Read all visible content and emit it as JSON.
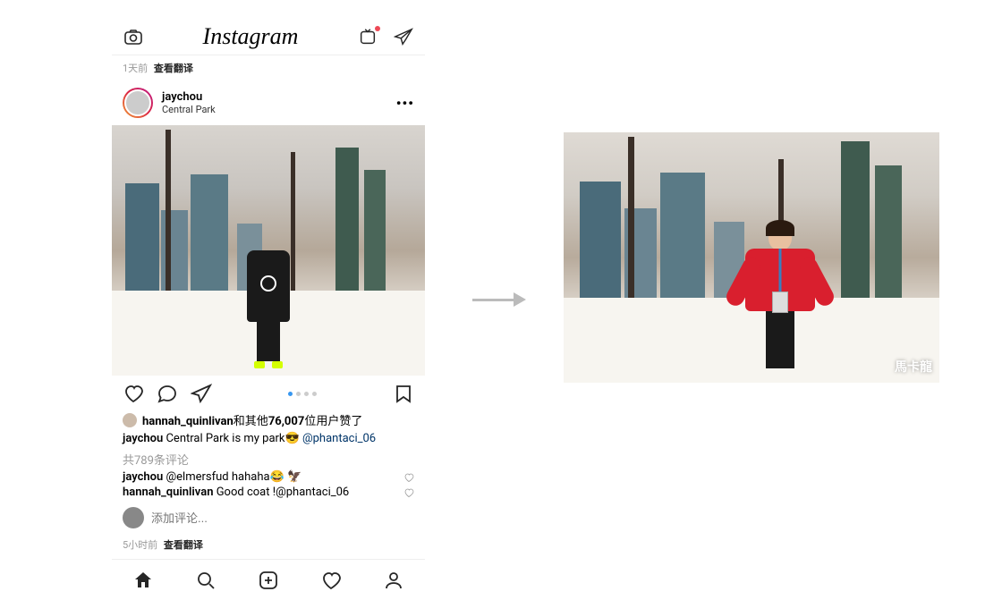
{
  "header": {
    "logo": "Instagram"
  },
  "top_meta": {
    "time": "1天前",
    "translate": "查看翻译"
  },
  "post": {
    "username": "jaychou",
    "location": "Central Park",
    "pager": {
      "count": 4,
      "active": 0
    },
    "likes": {
      "liker": "hannah_quinlivan",
      "text_mid": "和其他",
      "count": "76,007",
      "text_suffix": "位用户赞了"
    },
    "caption": {
      "user": "jaychou",
      "text": "Central Park is my park😎 ",
      "tag": "@phantaci_06"
    },
    "comments_count": "共789条评论",
    "comments": [
      {
        "user": "jaychou",
        "mention": "@elmersfud",
        "text": " hahaha😂 🦅"
      },
      {
        "user": "hannah_quinlivan",
        "mention": "",
        "text": "Good coat !",
        "tag": "@phantaci_06"
      }
    ],
    "add_comment_placeholder": "添加评论...",
    "time_row": {
      "time": "5小时前",
      "translate": "查看翻译"
    }
  },
  "right_image": {
    "watermark": "馬卡龍"
  }
}
